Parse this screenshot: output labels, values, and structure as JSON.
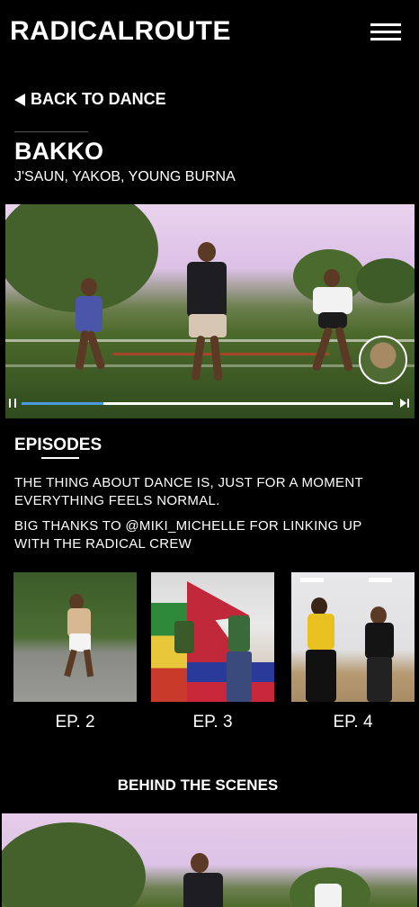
{
  "header": {
    "logo": "RADICALROUTE",
    "menu_icon": "hamburger-menu-icon"
  },
  "nav": {
    "back_label": "BACK TO DANCE"
  },
  "dance": {
    "title": "BAKKO",
    "artists": "J'SAUN, YAKOB, YOUNG BURNA"
  },
  "video": {
    "progress": 0.22
  },
  "episodes": {
    "heading": "EPISODES",
    "description": [
      "THE THING ABOUT DANCE IS, JUST FOR A MOMENT EVERYTHING FEELS NORMAL.",
      "BIG THANKS TO @MIKI_MICHELLE FOR LINKING UP WITH THE RADICAL CREW"
    ],
    "items": [
      {
        "label": "EP. 2"
      },
      {
        "label": "EP. 3"
      },
      {
        "label": "EP. 4"
      }
    ]
  },
  "behind": {
    "heading": "BEHIND THE SCENES"
  },
  "colors": {
    "background": "#000000",
    "text": "#ffffff",
    "progress": "#4a9be0"
  }
}
